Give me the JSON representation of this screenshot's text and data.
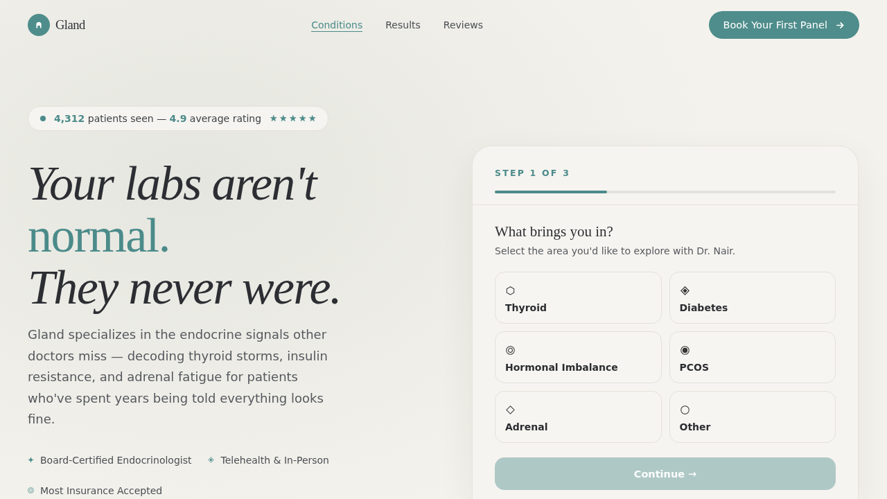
{
  "header": {
    "brand": "Gland",
    "nav": [
      {
        "label": "Conditions",
        "selected": true
      },
      {
        "label": "Results",
        "selected": false
      },
      {
        "label": "Reviews",
        "selected": false
      }
    ],
    "cta": "Book Your First Panel"
  },
  "hero": {
    "badge": {
      "text": "**4,312** patients seen — **4.9** average rating",
      "stars": 5
    },
    "headline": [
      {
        "text": "Your labs aren't",
        "kind": "italic"
      },
      {
        "text": "normal.",
        "kind": "accent"
      },
      {
        "text": "They never were.",
        "kind": "italic"
      }
    ],
    "intro": "Gland specializes in the endocrine signals other doctors miss — decoding thyroid storms, insulin resistance, and adrenal fatigue for patients who've spent years being told everything looks fine.",
    "features": [
      {
        "label": "Board-Certified Endocrinologist"
      },
      {
        "label": "Telehealth & In-Person"
      },
      {
        "label": "Most Insurance Accepted"
      }
    ]
  },
  "intake": {
    "step": "STEP 1 OF 3",
    "level": 0.33,
    "question": "What brings you in?",
    "hint": "Select the area you'd like to explore with Dr. Nair.",
    "options": [
      {
        "label": "Thyroid",
        "selected": false
      },
      {
        "label": "Diabetes",
        "selected": false
      },
      {
        "label": "Hormonal Imbalance",
        "selected": false
      },
      {
        "label": "PCOS",
        "selected": false
      },
      {
        "label": "Adrenal",
        "selected": false
      },
      {
        "label": "Other",
        "selected": false
      }
    ],
    "continue": {
      "label": "Continue →",
      "disabled": true
    }
  }
}
